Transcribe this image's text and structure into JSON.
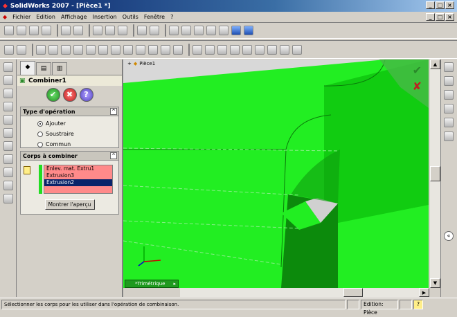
{
  "window": {
    "title": "SolidWorks 2007 - [Pièce1 *]"
  },
  "menu": [
    "Fichier",
    "Edition",
    "Affichage",
    "Insertion",
    "Outils",
    "Fenêtre",
    "?"
  ],
  "panel": {
    "title": "Combiner1",
    "operation": {
      "header": "Type d'opération",
      "options": [
        "Ajouter",
        "Soustraire",
        "Commun"
      ],
      "selected": "Ajouter"
    },
    "bodies": {
      "header": "Corps à combiner",
      "items": [
        "Enlev. mat. Extru1",
        "Extrusion3",
        "Extrusion2"
      ],
      "selected_index": 2,
      "preview_button": "Montrer l'aperçu"
    }
  },
  "viewport": {
    "tree_label": "Pièce1",
    "view_label": "*Trimétrique",
    "colors": {
      "body": "#11ee11",
      "dark": "#0c8a0c",
      "accent": "#44bb44",
      "background": "#d8d8d8"
    }
  },
  "status": {
    "message": "Sélectionner les corps pour les utiliser dans l'opération de combinaison.",
    "mode": "Edition: Pièce",
    "help": "?"
  },
  "icons": [
    "solidworks-logo-icon",
    "ok-check-icon",
    "cancel-x-icon",
    "help-icon",
    "rotate-icon",
    "zoom-icon",
    "pan-icon",
    "triad-icon"
  ]
}
